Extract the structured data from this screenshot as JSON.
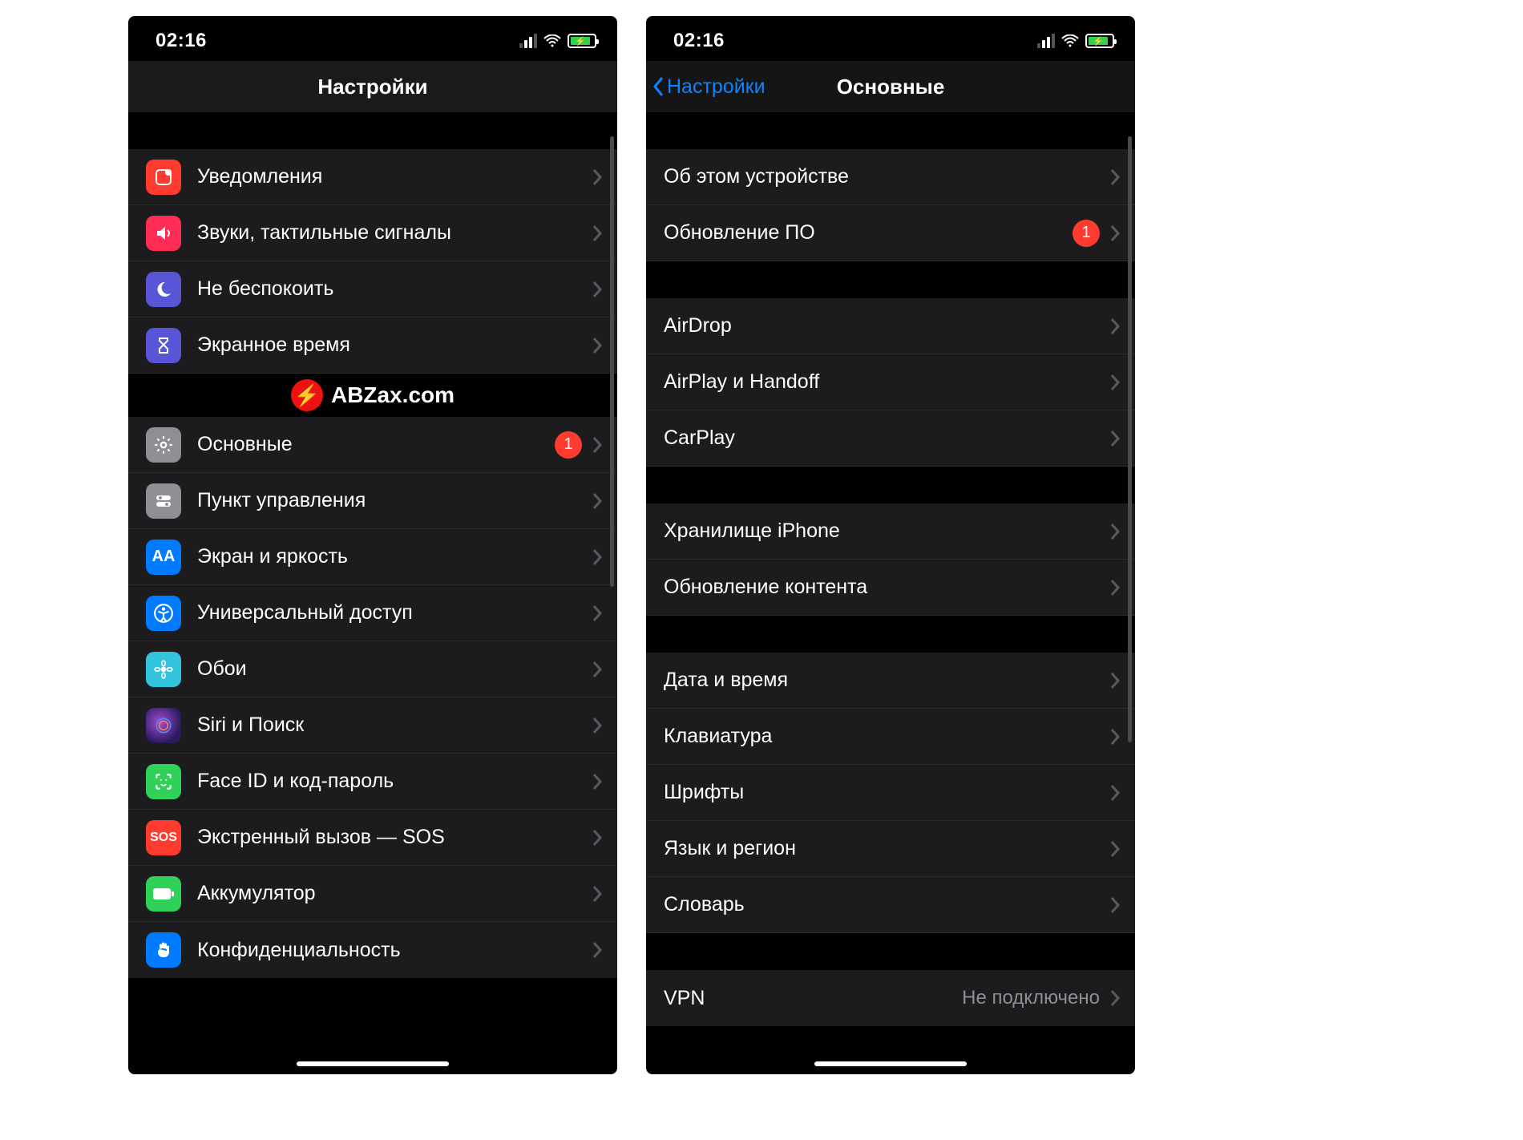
{
  "statusbar": {
    "time": "02:16"
  },
  "watermark": "ABZax.com",
  "left": {
    "title": "Настройки",
    "group1": [
      {
        "icon": "notifications",
        "color": "#ff3b30",
        "label": "Уведомления"
      },
      {
        "icon": "sounds",
        "color": "#ff2d55",
        "label": "Звуки, тактильные сигналы"
      },
      {
        "icon": "dnd",
        "color": "#5856d6",
        "label": "Не беспокоить"
      },
      {
        "icon": "screentime",
        "color": "#5856d6",
        "label": "Экранное время"
      }
    ],
    "group2": [
      {
        "icon": "general",
        "color": "#8e8e93",
        "label": "Основные",
        "badge": "1"
      },
      {
        "icon": "control",
        "color": "#8e8e93",
        "label": "Пункт управления"
      },
      {
        "icon": "display",
        "color": "#007aff",
        "label": "Экран и яркость"
      },
      {
        "icon": "accessibility",
        "color": "#007aff",
        "label": "Универсальный доступ"
      },
      {
        "icon": "wallpaper",
        "color": "#34c3dd",
        "label": "Обои"
      },
      {
        "icon": "siri",
        "color": "#222",
        "label": "Siri и Поиск"
      },
      {
        "icon": "faceid",
        "color": "#30d158",
        "label": "Face ID и код-пароль"
      },
      {
        "icon": "sos",
        "color": "#ff3b30",
        "label": "Экстренный вызов — SOS"
      },
      {
        "icon": "battery",
        "color": "#30d158",
        "label": "Аккумулятор"
      },
      {
        "icon": "privacy",
        "color": "#007aff",
        "label": "Конфиденциальность"
      }
    ]
  },
  "right": {
    "back": "Настройки",
    "title": "Основные",
    "groups": [
      [
        {
          "label": "Об этом устройстве"
        },
        {
          "label": "Обновление ПО",
          "badge": "1"
        }
      ],
      [
        {
          "label": "AirDrop"
        },
        {
          "label": "AirPlay и Handoff"
        },
        {
          "label": "CarPlay"
        }
      ],
      [
        {
          "label": "Хранилище iPhone"
        },
        {
          "label": "Обновление контента"
        }
      ],
      [
        {
          "label": "Дата и время"
        },
        {
          "label": "Клавиатура"
        },
        {
          "label": "Шрифты"
        },
        {
          "label": "Язык и регион"
        },
        {
          "label": "Словарь"
        }
      ],
      [
        {
          "label": "VPN",
          "value": "Не подключено"
        }
      ]
    ]
  }
}
